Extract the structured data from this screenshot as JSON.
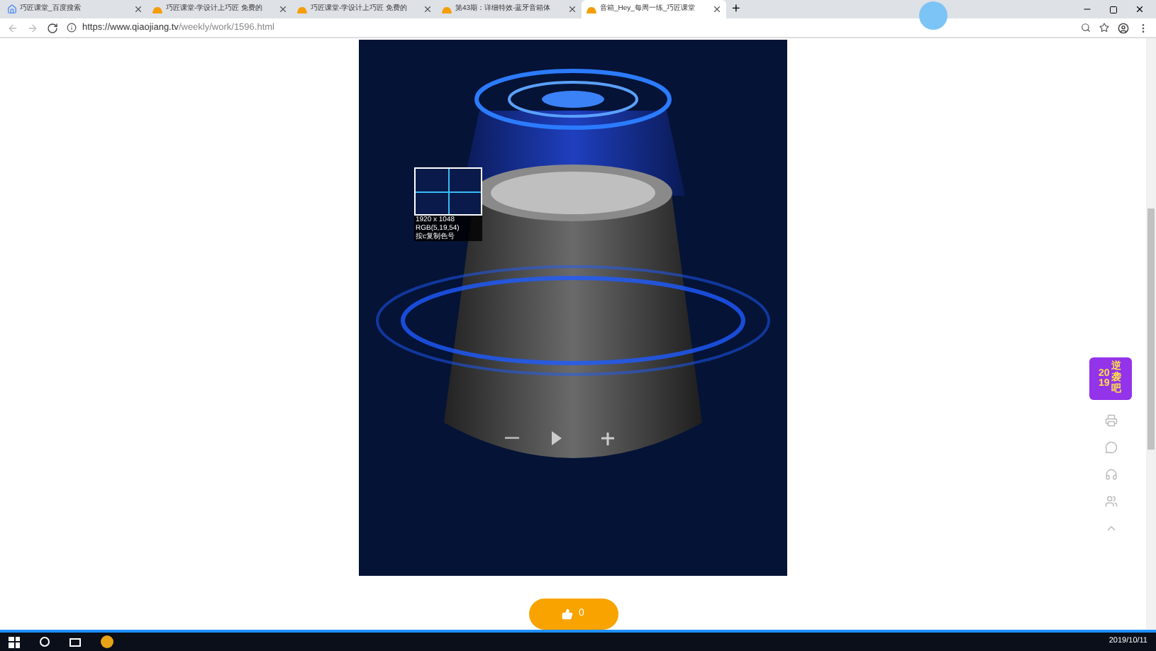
{
  "browser": {
    "tabs": [
      {
        "title": "巧匠课堂_百度搜索",
        "selected": false,
        "kind": "search"
      },
      {
        "title": "巧匠课堂-学设计上巧匠 免费的",
        "selected": false,
        "kind": "site"
      },
      {
        "title": "巧匠课堂-学设计上巧匠 免费的",
        "selected": false,
        "kind": "site"
      },
      {
        "title": "第43期：详细特效-蓝牙音箱体",
        "selected": false,
        "kind": "site"
      },
      {
        "title": "音箱_Hey_每周一练_巧匠课堂",
        "selected": true,
        "kind": "site"
      }
    ],
    "new_tab": "+",
    "url_host": "https://www.qiaojiang.tv",
    "url_path": "/weekly/work/1596.html"
  },
  "color_picker": {
    "size": "1920 x 1048",
    "rgb": "RGB(5,19,54)",
    "hint": "按c复制色号"
  },
  "promo_badge": {
    "year": "2019",
    "text": "逆袭吧"
  },
  "like_button": {
    "count": "0"
  },
  "taskbar": {
    "date": "2019/10/11"
  }
}
